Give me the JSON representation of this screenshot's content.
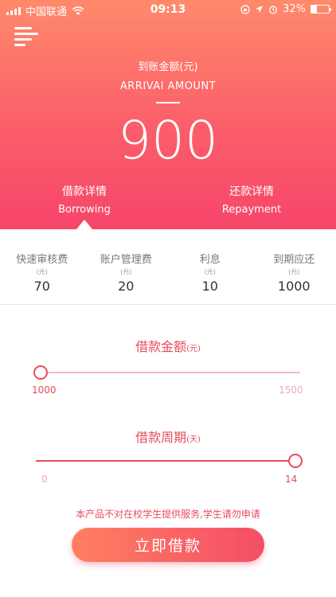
{
  "status_bar": {
    "carrier": "中国联通",
    "time": "09:13",
    "battery_percent": "32%",
    "battery_level": 0.32
  },
  "header": {
    "amount_label": "到账金额(元)",
    "amount_label_en": "ARRIVAI AMOUNT",
    "amount_value": "900"
  },
  "tabs": [
    {
      "label": "借款详情",
      "label_en": "Borrowing",
      "active": true
    },
    {
      "label": "还款详情",
      "label_en": "Repayment",
      "active": false
    }
  ],
  "fees": [
    {
      "name": "快速审核费",
      "unit": "(元)",
      "value": "70"
    },
    {
      "name": "账户管理费",
      "unit": "(元)",
      "value": "20"
    },
    {
      "name": "利息",
      "unit": "(元)",
      "value": "10"
    },
    {
      "name": "到期应还",
      "unit": "(元)",
      "value": "1000"
    }
  ],
  "amount_slider": {
    "title": "借款金额",
    "unit": "(元)",
    "min_label": "1000",
    "max_label": "1500",
    "min": 1000,
    "max": 1500,
    "value": 1000
  },
  "period_slider": {
    "title": "借款周期",
    "unit": "(天)",
    "min_label": "0",
    "max_label": "14",
    "min": 0,
    "max": 14,
    "value": 14
  },
  "notice": "本产品不对在校学生提供服务,学生请勿申请",
  "apply_button": "立即借款",
  "colors": {
    "accent": "#e84c5d",
    "gradient_top": "#ff8a6b",
    "gradient_bottom": "#f6456a"
  }
}
